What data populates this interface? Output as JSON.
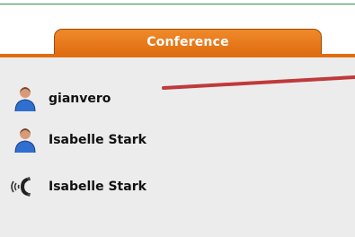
{
  "tab": {
    "label": "Conference"
  },
  "participants": [
    {
      "name": "gianvero",
      "icon": "user-icon"
    },
    {
      "name": "Isabelle Stark",
      "icon": "user-icon"
    },
    {
      "name": "Isabelle Stark",
      "icon": "phone-speaker-icon"
    }
  ],
  "colors": {
    "tab": "#e06d10",
    "panel": "#ececec",
    "pointer": "#c0393b"
  }
}
